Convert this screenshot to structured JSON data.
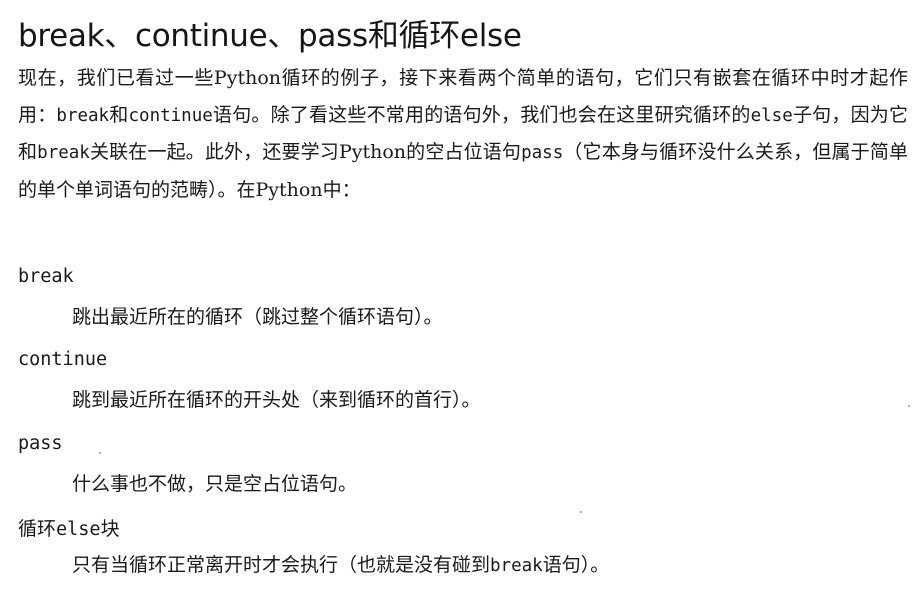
{
  "heading": {
    "title": "break、continue、pass和循环else"
  },
  "intro": {
    "part1": "现在，我们已看过一些Python循环的例子，接下来看两个简单的语句，它们只有嵌套在循环中时才起作用：",
    "kw_break": "break",
    "part2": "和",
    "kw_continue": "continue",
    "part3": "语句。除了看这些不常用的语句外，我们也会在这里研究循环的",
    "kw_else": "else",
    "part4": "子句，因为它和",
    "kw_break2": "break",
    "part5": "关联在一起。此外，还要学习Python的空占位语句",
    "kw_pass": "pass",
    "part6": "（它本身与循环没什么关系，但属于简单的单个单词语句的范畴）。在Python中："
  },
  "definitions": [
    {
      "term": "break",
      "desc": "跳出最近所在的循环（跳过整个循环语句）。"
    },
    {
      "term": "continue",
      "desc": "跳到最近所在循环的开头处（来到循环的首行）。"
    },
    {
      "term": "pass",
      "desc": "什么事也不做，只是空占位语句。"
    },
    {
      "term_cjk": "循环",
      "term_kw": "else",
      "term_suffix": "块",
      "desc_part1": "只有当循环正常离开时才会执行（也就是没有碰到",
      "desc_kw": "break",
      "desc_part2": "语句）。"
    }
  ]
}
